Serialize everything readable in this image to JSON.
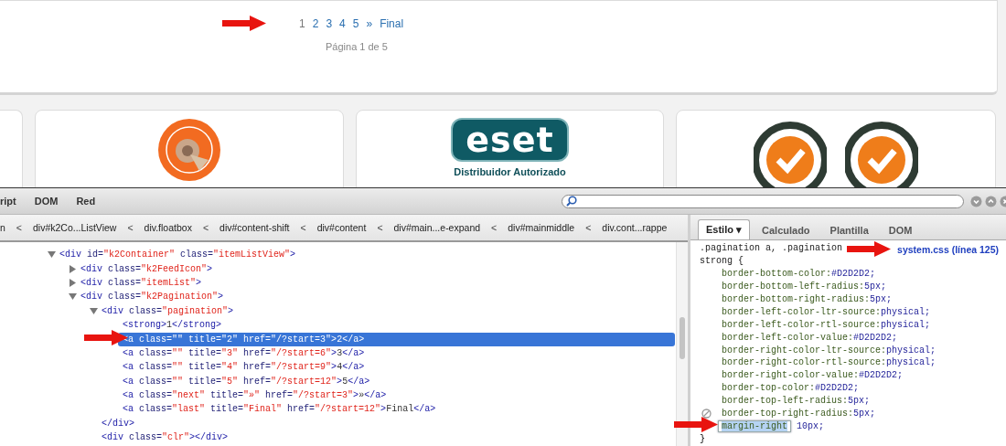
{
  "pagination": {
    "items": [
      {
        "label": "1",
        "selected": true
      },
      {
        "label": "2",
        "selected": false
      },
      {
        "label": "3",
        "selected": false
      },
      {
        "label": "4",
        "selected": false
      },
      {
        "label": "5",
        "selected": false
      },
      {
        "label": "»",
        "selected": false
      },
      {
        "label": "Final",
        "selected": false
      }
    ],
    "status": "Página 1 de 5"
  },
  "logo_cards": [
    {
      "kind": "empty"
    },
    {
      "kind": "seal"
    },
    {
      "kind": "brand",
      "logo_text": "eset",
      "caption": "Distribuidor Autorizado"
    },
    {
      "kind": "certification"
    }
  ],
  "devtools": {
    "toolbar_tabs": [
      {
        "label": "ript",
        "selected": false
      },
      {
        "label": "DOM",
        "selected": false
      },
      {
        "label": "Red",
        "selected": false
      }
    ],
    "breadcrumbs": [
      {
        "kind": "crumb",
        "label": "n"
      },
      {
        "kind": "separator",
        "label": "<"
      },
      {
        "kind": "crumb",
        "label": "div#k2Co...ListView"
      },
      {
        "kind": "separator",
        "label": "<"
      },
      {
        "kind": "crumb",
        "label": "div.floatbox"
      },
      {
        "kind": "separator",
        "label": "<"
      },
      {
        "kind": "crumb",
        "label": "div#content-shift"
      },
      {
        "kind": "separator",
        "label": "<"
      },
      {
        "kind": "crumb",
        "label": "div#content"
      },
      {
        "kind": "separator",
        "label": "<"
      },
      {
        "kind": "crumb",
        "label": "div#main...e-expand"
      },
      {
        "kind": "separator",
        "label": "<"
      },
      {
        "kind": "crumb",
        "label": "div#mainmiddle"
      },
      {
        "kind": "separator",
        "label": "<"
      },
      {
        "kind": "crumb",
        "label": "div.cont...rappe"
      }
    ],
    "tree": [
      {
        "kind": "element",
        "code": "<div id=\"k2Container\" class=\"itemListView\">",
        "expanded": true,
        "selected": false,
        "children": [
          {
            "kind": "element",
            "code": "<div class=\"k2FeedIcon\">",
            "expanded": false,
            "selected": false
          },
          {
            "kind": "element",
            "code": "<div class=\"itemList\">",
            "expanded": false,
            "selected": false
          },
          {
            "kind": "element",
            "code": "<div class=\"k2Pagination\">",
            "expanded": true,
            "selected": false,
            "children": [
              {
                "kind": "element",
                "code": "<div class=\"pagination\">",
                "expanded": true,
                "selected": false,
                "children": [
                  {
                    "kind": "leaf",
                    "code": "<strong>1</strong>",
                    "selected": false
                  },
                  {
                    "kind": "leaf",
                    "code": "<a class=\"\" title=\"2\" href=\"/?start=3\">2</a>",
                    "selected": true
                  },
                  {
                    "kind": "leaf",
                    "code": "<a class=\"\" title=\"3\" href=\"/?start=6\">3</a>",
                    "selected": false
                  },
                  {
                    "kind": "leaf",
                    "code": "<a class=\"\" title=\"4\" href=\"/?start=9\">4</a>",
                    "selected": false
                  },
                  {
                    "kind": "leaf",
                    "code": "<a class=\"\" title=\"5\" href=\"/?start=12\">5</a>",
                    "selected": false
                  },
                  {
                    "kind": "leaf",
                    "code": "<a class=\"next\" title=\"»\" href=\"/?start=3\">»</a>",
                    "selected": false
                  },
                  {
                    "kind": "leaf",
                    "code": "<a class=\"last\" title=\"Final\" href=\"/?start=12\">Final</a>",
                    "selected": false
                  }
                ]
              },
              {
                "kind": "leaf",
                "code": "</div>",
                "selected": false
              },
              {
                "kind": "leaf",
                "code": "<div class=\"clr\"></div>",
                "selected": false
              }
            ]
          }
        ]
      }
    ],
    "side_tabs": [
      {
        "label": "Estilo ▾",
        "selected": true
      },
      {
        "label": "Calculado",
        "selected": false
      },
      {
        "label": "Plantilla",
        "selected": false
      },
      {
        "label": "DOM",
        "selected": false
      }
    ],
    "rule": {
      "selector": [
        ".pagination a, .pagination",
        "strong {"
      ],
      "source": "system.css (línea 125)",
      "properties": [
        {
          "name": "border-bottom-color:",
          "value": "#D2D2D2;",
          "hovered": false,
          "editing": false
        },
        {
          "name": "border-bottom-left-radius:",
          "value": "5px;",
          "hovered": false,
          "editing": false
        },
        {
          "name": "border-bottom-right-radius:",
          "value": "5px;",
          "hovered": false,
          "editing": false
        },
        {
          "name": "border-left-color-ltr-source:",
          "value": "physical;",
          "hovered": false,
          "editing": false
        },
        {
          "name": "border-left-color-rtl-source:",
          "value": "physical;",
          "hovered": false,
          "editing": false
        },
        {
          "name": "border-left-color-value:",
          "value": "#D2D2D2;",
          "hovered": false,
          "editing": false
        },
        {
          "name": "border-right-color-ltr-source:",
          "value": "physical;",
          "hovered": false,
          "editing": false
        },
        {
          "name": "border-right-color-rtl-source:",
          "value": "physical;",
          "hovered": false,
          "editing": false
        },
        {
          "name": "border-right-color-value:",
          "value": "#D2D2D2;",
          "hovered": false,
          "editing": false
        },
        {
          "name": "border-top-color:",
          "value": "#D2D2D2;",
          "hovered": false,
          "editing": false
        },
        {
          "name": "border-top-left-radius:",
          "value": "5px;",
          "hovered": false,
          "editing": false
        },
        {
          "name": "border-top-right-radius:",
          "value": "5px;",
          "hovered": true,
          "editing": false
        },
        {
          "name": "margin-right",
          "value": "10px;",
          "hovered": false,
          "editing": true
        }
      ],
      "closing": "}"
    }
  }
}
